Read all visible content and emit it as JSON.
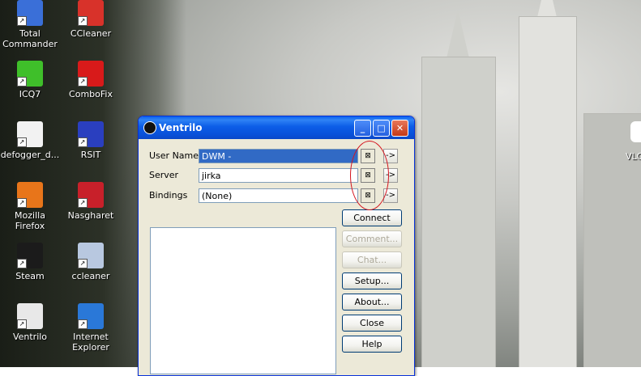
{
  "desktop": {
    "icons": [
      {
        "label": "Total\nCommander",
        "icon": "floppy-disk-icon",
        "color": "#3a6fd8"
      },
      {
        "label": "CCleaner",
        "icon": "ccleaner-icon",
        "color": "#d8322a"
      },
      {
        "label": "ICQ7",
        "icon": "icq-flower-icon",
        "color": "#3fbf2a"
      },
      {
        "label": "ComboFix",
        "icon": "combofix-icon",
        "color": "#d81a1a"
      },
      {
        "label": "defogger_d...",
        "icon": "text-file-icon",
        "color": "#f2f2f2"
      },
      {
        "label": "RSIT",
        "icon": "rsit-icon",
        "color": "#2a3fbf"
      },
      {
        "label": "Mozilla Firefox",
        "icon": "firefox-icon",
        "color": "#e8751a"
      },
      {
        "label": "Nasgharet",
        "icon": "nasgharet-icon",
        "color": "#c8202a"
      },
      {
        "label": "Steam",
        "icon": "steam-icon",
        "color": "#1b1b1b"
      },
      {
        "label": "ccleaner",
        "icon": "installer-disc-icon",
        "color": "#b8c8e0"
      },
      {
        "label": "Ventrilo",
        "icon": "ventrilo-icon",
        "color": "#e8e8e8"
      },
      {
        "label": "Internet\nExplorer",
        "icon": "internet-explorer-icon",
        "color": "#2a78d8"
      }
    ],
    "edge_label": "VLC pl"
  },
  "window": {
    "title": "Ventrilo",
    "controls": {
      "minimize": "_",
      "maximize": "□",
      "close": "✕"
    },
    "rows": [
      {
        "label": "User Name",
        "value": "DWM -",
        "selected": true
      },
      {
        "label": "Server",
        "value": "jirka",
        "selected": false
      },
      {
        "label": "Bindings",
        "value": "(None)",
        "selected": false
      }
    ],
    "row_button_glyph": "⊠",
    "arrow_glyph": "->",
    "buttons": [
      {
        "label": "Connect",
        "enabled": true
      },
      {
        "label": "Comment...",
        "enabled": false
      },
      {
        "label": "Chat...",
        "enabled": false
      },
      {
        "label": "Setup...",
        "enabled": true
      },
      {
        "label": "About...",
        "enabled": true
      },
      {
        "label": "Close",
        "enabled": true
      },
      {
        "label": "Help",
        "enabled": true
      }
    ]
  }
}
